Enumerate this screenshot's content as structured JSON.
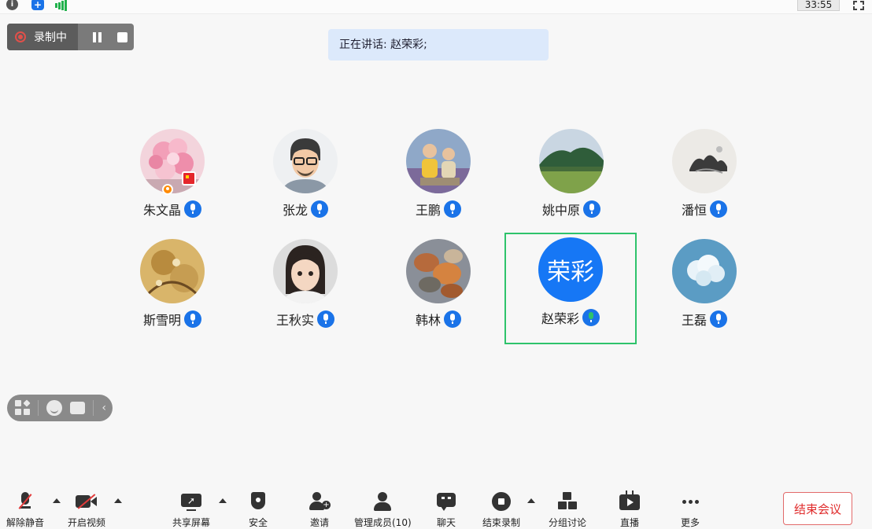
{
  "status_bar": {
    "timer": "33:55"
  },
  "recording": {
    "label": "录制中"
  },
  "speaking": {
    "text": "正在讲话: 赵荣彩;"
  },
  "participants": [
    {
      "name": "朱文晶",
      "avatar": "hyacinth-photo",
      "mic": "on",
      "host": true
    },
    {
      "name": "张龙",
      "avatar": "cartoon-man",
      "mic": "on"
    },
    {
      "name": "王鹏",
      "avatar": "kids-photo",
      "mic": "on"
    },
    {
      "name": "姚中原",
      "avatar": "garden-photo",
      "mic": "on"
    },
    {
      "name": "潘恒",
      "avatar": "ink-landscape",
      "mic": "on"
    },
    {
      "name": "斯雪明",
      "avatar": "painting",
      "mic": "on"
    },
    {
      "name": "王秋实",
      "avatar": "girl-photo",
      "mic": "on"
    },
    {
      "name": "韩林",
      "avatar": "stones-photo",
      "mic": "on"
    },
    {
      "name": "赵荣彩",
      "avatar_text": "荣彩",
      "mic": "speaking",
      "active": true
    },
    {
      "name": "王磊",
      "avatar": "cloud-sky",
      "mic": "on"
    }
  ],
  "toolbar": {
    "unmute": "解除静音",
    "start_video": "开启视频",
    "share_screen": "共享屏幕",
    "security": "安全",
    "invite": "邀请",
    "manage_members": "管理成员(10)",
    "chat": "聊天",
    "end_recording": "结束录制",
    "breakout": "分组讨论",
    "live": "直播",
    "more": "更多",
    "end_meeting": "结束会议"
  },
  "colors": {
    "accent": "#1677f5",
    "active_border": "#2ec36b",
    "end_meeting": "#e02b2b",
    "speaking_bg": "#dce9fb"
  }
}
